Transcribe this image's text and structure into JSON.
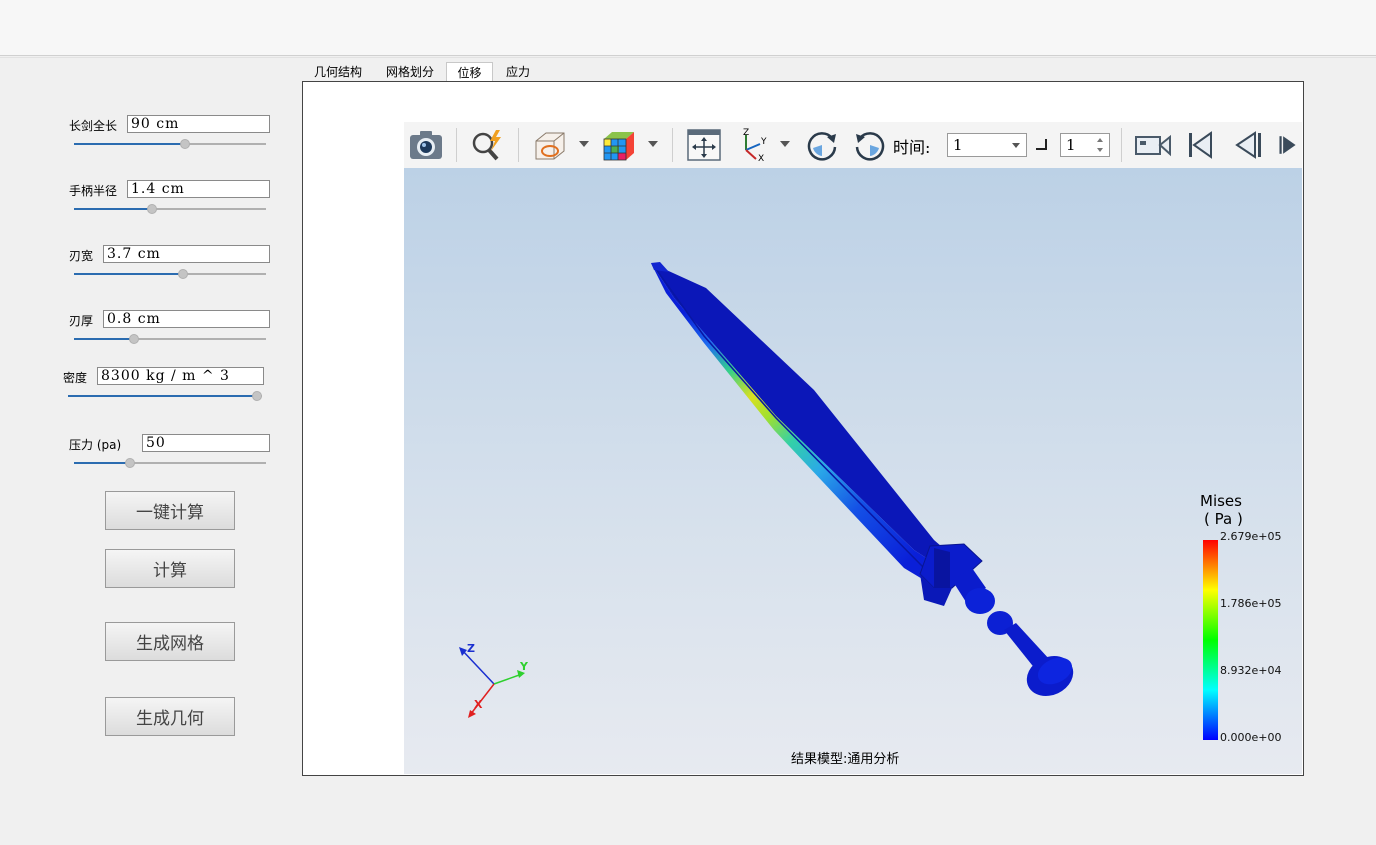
{
  "params": [
    {
      "label": "长剑全长",
      "value": "90 cm",
      "level": 0.58
    },
    {
      "label": "手柄半径",
      "value": "1.4 cm",
      "level": 0.4
    },
    {
      "label": "刃宽",
      "value": "3.7 cm",
      "level": 0.57
    },
    {
      "label": "刃厚",
      "value": "0.8 cm",
      "level": 0.3
    },
    {
      "label": "密度",
      "value": "8300 kg / m ^ 3",
      "level": 1.0
    },
    {
      "label": "压力 (pa)",
      "value": "50",
      "level": 0.28
    }
  ],
  "buttons": {
    "one_click": "一键计算",
    "compute": "计算",
    "mesh": "生成网格",
    "geometry": "生成几何"
  },
  "tabs": [
    "几何结构",
    "网格划分",
    "位移",
    "应力"
  ],
  "active_tab": "位移",
  "toolbar": {
    "time_label": "时间:",
    "time_value": "1",
    "step_value": "1"
  },
  "legend": {
    "title": "Mises",
    "unit": "( Pa )",
    "max": "2.679e+05",
    "mid_high": "1.786e+05",
    "mid_low": "8.932e+04",
    "min": "0.000e+00"
  },
  "axes": {
    "x": "X",
    "y": "Y",
    "z": "Z"
  },
  "caption": "结果模型:通用分析",
  "colors": {
    "accent": "#2b6cb0",
    "model": "#0a1fd8"
  }
}
